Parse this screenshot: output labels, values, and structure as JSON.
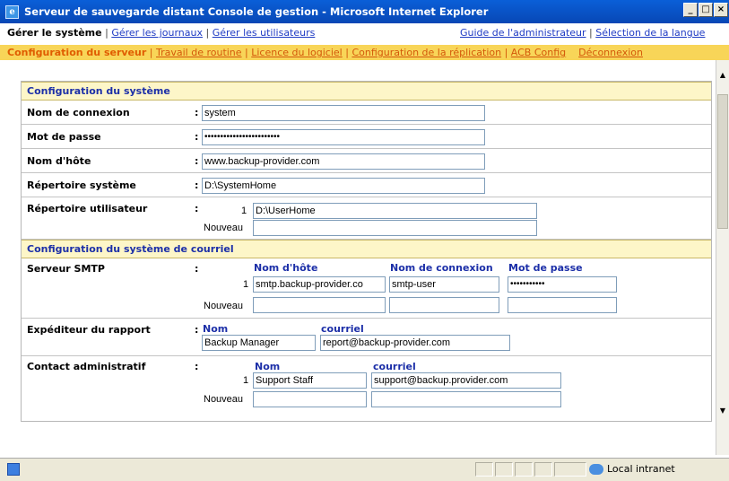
{
  "window": {
    "title": "Serveur de sauvegarde distant Console de gestion - Microsoft Internet Explorer"
  },
  "nav_primary": {
    "left": [
      "Gérer le système",
      "Gérer les journaux",
      "Gérer les utilisateurs"
    ],
    "right": [
      "Guide de l'administrateur",
      "Sélection de la langue"
    ]
  },
  "nav_secondary": [
    "Configuration du serveur",
    "Travail de routine",
    "Licence du logiciel",
    "Configuration de la réplication",
    "ACB Config",
    "Déconnexion"
  ],
  "system_config": {
    "header": "Configuration du système",
    "login_label": "Nom de connexion",
    "login_value": "system",
    "password_label": "Mot de passe",
    "password_value": "••••••••••••••••••••••••",
    "host_label": "Nom d'hôte",
    "host_value": "www.backup-provider.com",
    "sysdir_label": "Répertoire système",
    "sysdir_value": "D:\\SystemHome",
    "userdir_label": "Répertoire utilisateur",
    "userdir_index": "1",
    "userdir_value": "D:\\UserHome",
    "new_label": "Nouveau"
  },
  "mail_config": {
    "header": "Configuration du système de courriel",
    "smtp_label": "Serveur SMTP",
    "col_host": "Nom d'hôte",
    "col_login": "Nom de connexion",
    "col_password": "Mot de passe",
    "smtp_index": "1",
    "smtp_host": "smtp.backup-provider.co",
    "smtp_user": "smtp-user",
    "smtp_password": "•••••••••••",
    "new_label": "Nouveau",
    "sender_label": "Expéditeur du rapport",
    "col_name": "Nom",
    "col_email": "courriel",
    "sender_name": "Backup Manager",
    "sender_email": "report@backup-provider.com",
    "admin_label": "Contact administratif",
    "admin_index": "1",
    "admin_name": "Support Staff",
    "admin_email": "support@backup.provider.com"
  },
  "colon": ":",
  "status": {
    "zone": "Local intranet"
  }
}
